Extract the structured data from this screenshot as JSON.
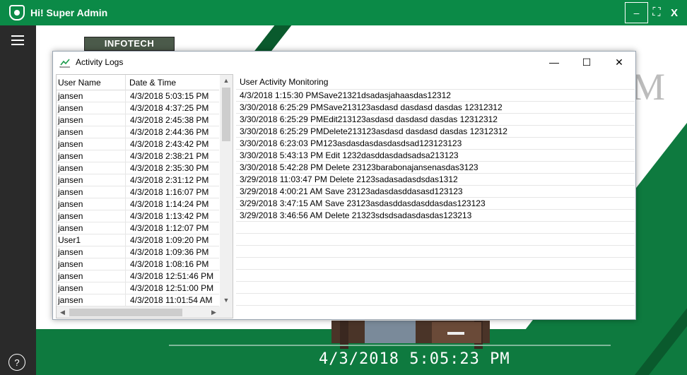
{
  "app": {
    "title": "Hi! Super Admin",
    "minimize_label": "–",
    "maximize_label": "⛶",
    "close_label": "X",
    "help_label": "?",
    "college_name": "INFOTECH COLLEGE",
    "bg_letter": "M",
    "clock": "4/3/2018 5:05:23 PM"
  },
  "window": {
    "title": "Activity Logs",
    "minimize_label": "—",
    "maximize_label": "☐",
    "close_label": "✕"
  },
  "grid": {
    "columns": [
      "User Name",
      "Date & Time"
    ],
    "rows": [
      {
        "user": "jansen",
        "datetime": "4/3/2018 5:03:15 PM"
      },
      {
        "user": "jansen",
        "datetime": "4/3/2018 4:37:25 PM"
      },
      {
        "user": "jansen",
        "datetime": "4/3/2018 2:45:38 PM"
      },
      {
        "user": "jansen",
        "datetime": "4/3/2018 2:44:36 PM"
      },
      {
        "user": "jansen",
        "datetime": "4/3/2018 2:43:42 PM"
      },
      {
        "user": "jansen",
        "datetime": "4/3/2018 2:38:21 PM"
      },
      {
        "user": "jansen",
        "datetime": "4/3/2018 2:35:30 PM"
      },
      {
        "user": "jansen",
        "datetime": "4/3/2018 2:31:12 PM"
      },
      {
        "user": "jansen",
        "datetime": "4/3/2018 1:16:07 PM"
      },
      {
        "user": "jansen",
        "datetime": "4/3/2018 1:14:24 PM"
      },
      {
        "user": "jansen",
        "datetime": "4/3/2018 1:13:42 PM"
      },
      {
        "user": "jansen",
        "datetime": "4/3/2018 1:12:07 PM"
      },
      {
        "user": "User1",
        "datetime": "4/3/2018 1:09:20 PM"
      },
      {
        "user": "jansen",
        "datetime": "4/3/2018 1:09:36 PM"
      },
      {
        "user": "jansen",
        "datetime": "4/3/2018 1:08:16 PM"
      },
      {
        "user": "jansen",
        "datetime": "4/3/2018 12:51:46 PM"
      },
      {
        "user": "jansen",
        "datetime": "4/3/2018 12:51:00 PM"
      },
      {
        "user": "jansen",
        "datetime": "4/3/2018 11:01:54 AM"
      }
    ]
  },
  "activity": {
    "header": "User Activity Monitoring",
    "items": [
      "4/3/2018 1:15:30 PMSave21321dsadasjahaasdas12312",
      "3/30/2018 6:25:29 PMSave213123asdasd dasdasd dasdas 12312312",
      "3/30/2018 6:25:29 PMEdit213123asdasd dasdasd dasdas 12312312",
      "3/30/2018 6:25:29 PMDelete213123asdasd dasdasd dasdas 12312312",
      "3/30/2018 6:23:03 PM123asdasdasdasdasdsad123123123",
      "3/30/2018 5:43:13 PM Edit 1232dasddasdadsadsa213123",
      "3/30/2018 5:42:28 PM Delete 23123barabonajansenasdas3123",
      "3/29/2018 11:03:47 PM Delete 2123sadasadasdsdas1312",
      "3/29/2018 4:00:21 AM Save 23123adasdasddasasd123123",
      "3/29/2018 3:47:15 AM Save 23123asdasddasdasddasdas123123",
      "3/29/2018 3:46:56 AM Delete 21323sdsdsadasdasdas123213"
    ]
  },
  "colors": {
    "app_green": "#0b8a47",
    "sidebar": "#2a2a2a"
  }
}
